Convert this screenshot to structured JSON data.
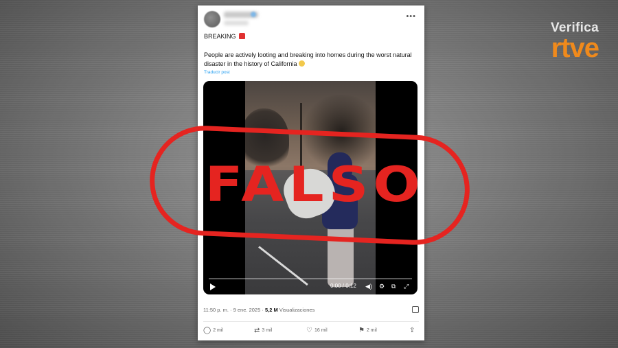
{
  "brand": {
    "verifica": "Verifica",
    "rtve": "rtve"
  },
  "tweet": {
    "headline": "BREAKING",
    "text": "People are actively looting and breaking into homes during the worst natural disaster in the history of California",
    "translate_link": "Traducir post",
    "more_icon": "•••",
    "timestamp": "11:50 p. m. · 9 ene. 2025 ·",
    "views_count": "5,2 M",
    "views_label": "Visualizaciones"
  },
  "video": {
    "time": "0:00 / 0:12",
    "progress": 0,
    "icons": [
      "play-icon",
      "volume-icon",
      "settings-icon",
      "pip-icon",
      "fullscreen-icon",
      "instagram-icon"
    ]
  },
  "stamp": {
    "text": "FALSO",
    "color": "#e52420"
  },
  "actions": {
    "reply": "2 mil",
    "repost": "3 mil",
    "like": "16 mil",
    "bookmark": "2 mil"
  },
  "colors": {
    "accent": "#1d9bf0",
    "brand_orange": "#f08a1c"
  }
}
